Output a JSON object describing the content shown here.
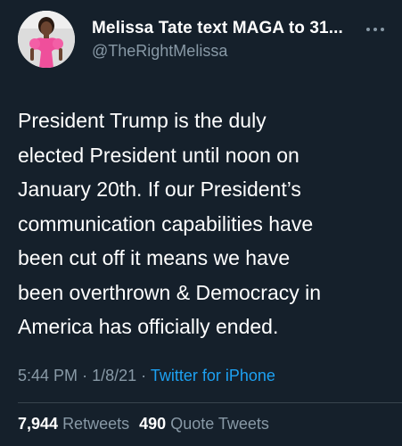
{
  "author": {
    "display_name": "Melissa Tate text MAGA to 31...",
    "handle": "@TheRightMelissa",
    "avatar_icon": "profile-photo"
  },
  "menu": {
    "icon": "more-horizontal-icon"
  },
  "tweet": {
    "lines": [
      "President Trump is the duly",
      "elected President until noon on",
      "January 20th. If our President’s",
      "communication capabilities have",
      "been cut off it means we have",
      "been overthrown & Democracy in",
      "America has officially ended."
    ]
  },
  "meta": {
    "time": "5:44 PM",
    "separator": "·",
    "date": "1/8/21",
    "source": "Twitter for iPhone"
  },
  "stats": {
    "retweets_count": "7,944",
    "retweets_label": "Retweets",
    "quote_count": "490",
    "quote_label": "Quote Tweets"
  },
  "colors": {
    "background": "#15202b",
    "secondary_text": "#8899a6",
    "link": "#1da1f2",
    "divider": "#38444d"
  }
}
